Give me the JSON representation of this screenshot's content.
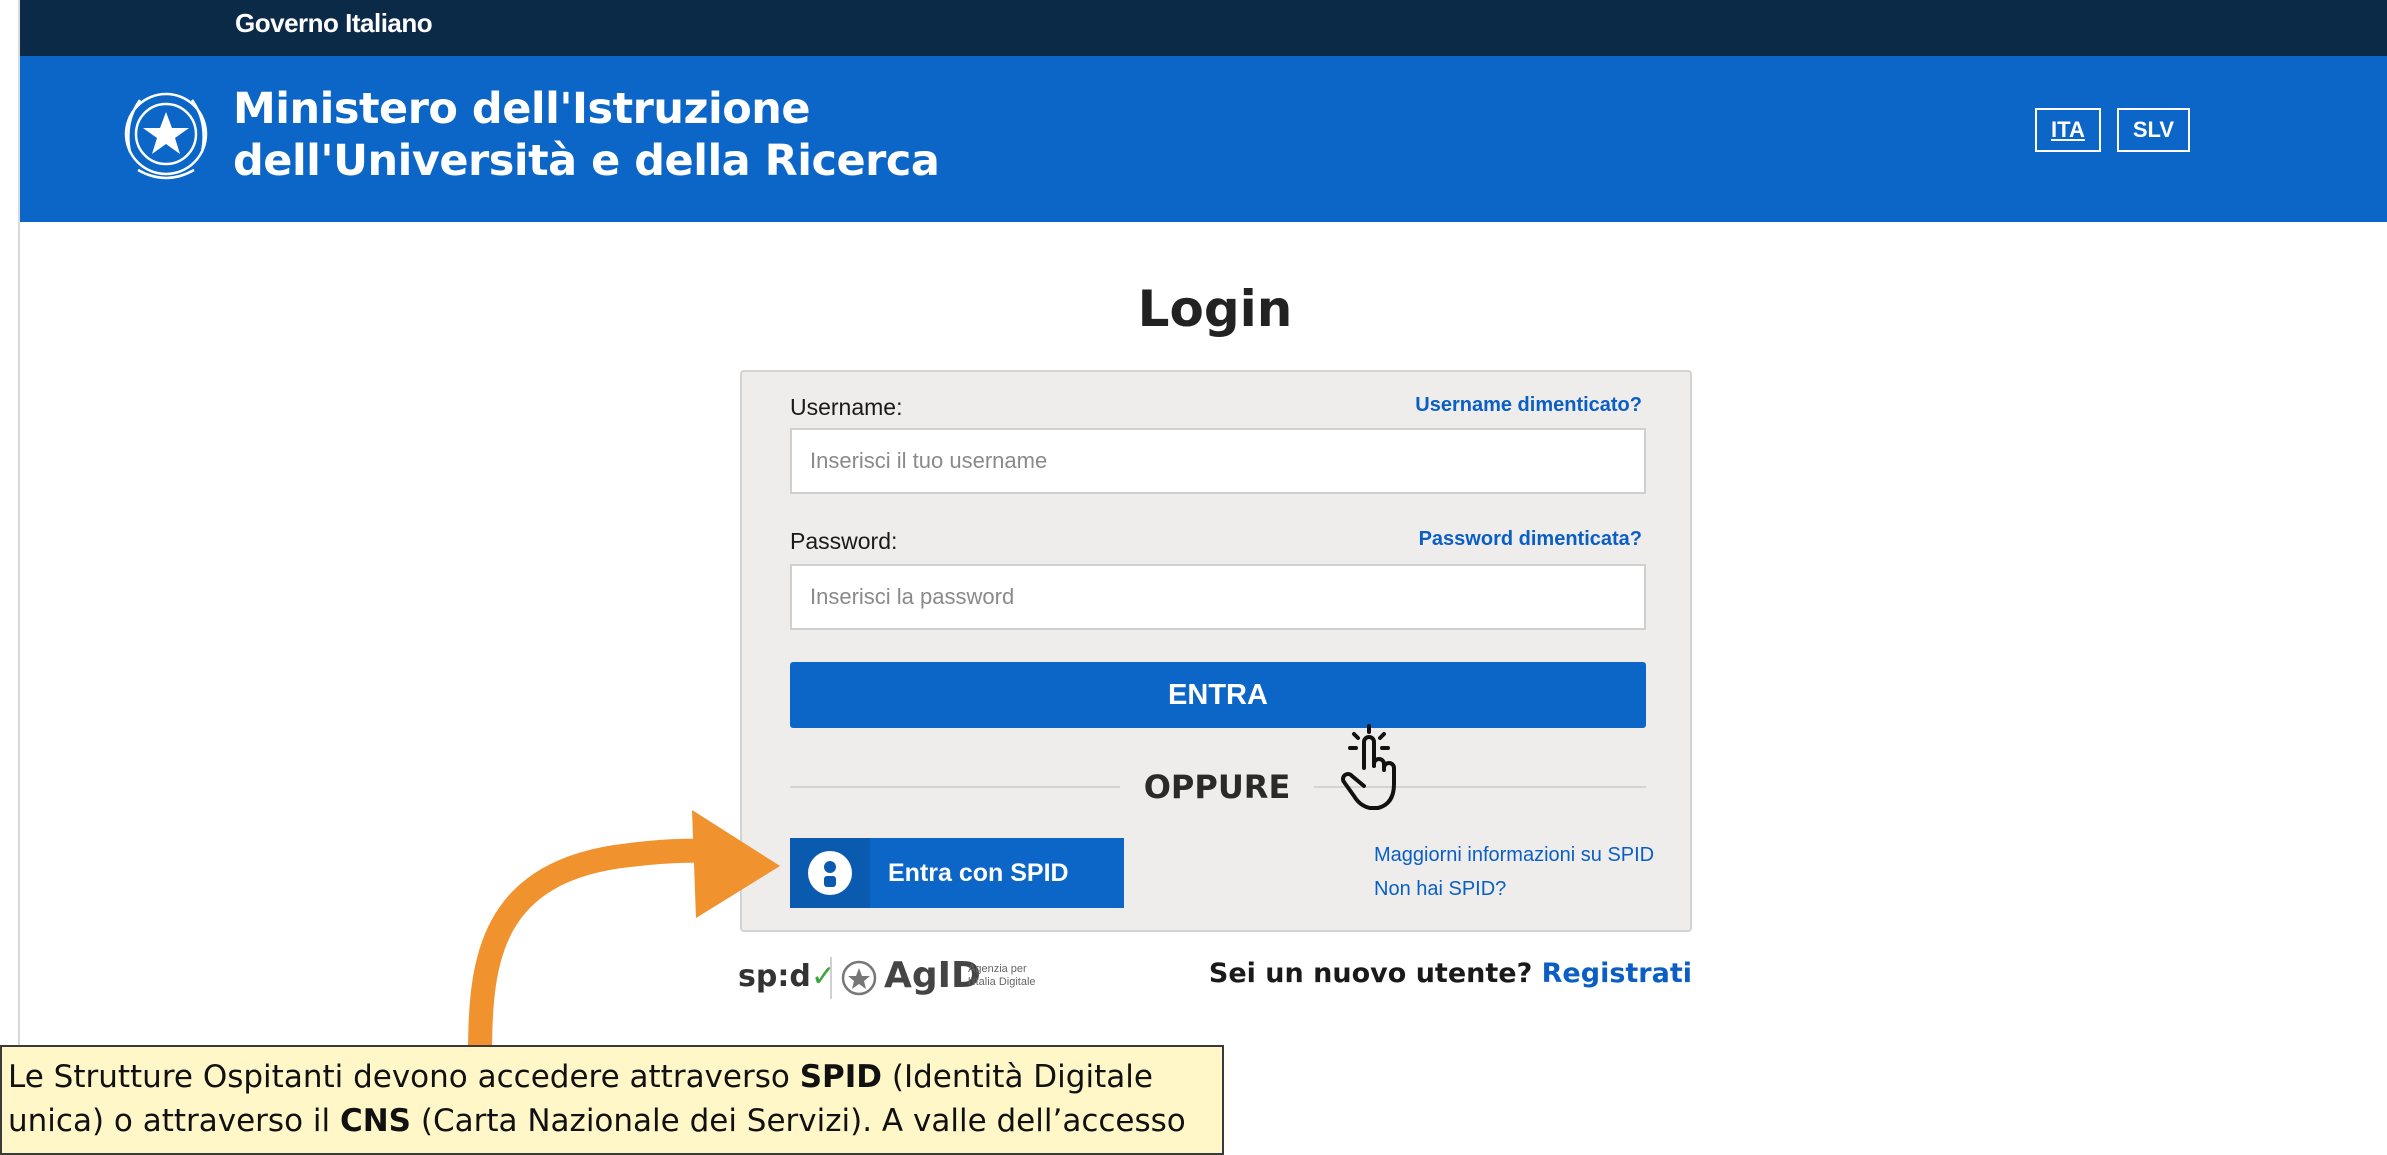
{
  "gov_bar": {
    "label": "Governo Italiano"
  },
  "header": {
    "title_line1": "Ministero dell'Istruzione",
    "title_line2": "dell'Università e della Ricerca",
    "languages": [
      {
        "label": "ITA",
        "active": true
      },
      {
        "label": "SLV",
        "active": false
      }
    ]
  },
  "login": {
    "title": "Login",
    "username_label": "Username:",
    "username_forgot": "Username dimenticato?",
    "username_placeholder": "Inserisci il tuo username",
    "password_label": "Password:",
    "password_forgot": "Password dimenticata?",
    "password_placeholder": "Inserisci la password",
    "submit_label": "ENTRA",
    "separator": "OPPURE",
    "spid_button": "Entra con SPID",
    "spid_more_info": "Maggiorni informazioni su SPID",
    "spid_none": "Non hai SPID?"
  },
  "footer": {
    "spid_logo": "sp:d",
    "agid_logo": "AgID",
    "agid_caption_line1": "Agenzia per",
    "agid_caption_line2": "l'Italia Digitale",
    "new_user_text": "Sei un nuovo utente?",
    "register_link": "Registrati"
  },
  "note": {
    "part1": "Le Strutture Ospitanti devono accedere attraverso ",
    "spid_bold": "SPID",
    "part2": " (Identità Digitale",
    "part3": "unica) o attraverso il ",
    "cns_bold": "CNS",
    "part4": " (Carta Nazionale dei Servizi). A valle dell’accesso"
  },
  "colors": {
    "gov_bar": "#0b2a48",
    "header_blue": "#0b66c8",
    "link_blue": "#0b5fc4",
    "arrow_orange": "#f0922e",
    "note_bg": "#fff7c8"
  }
}
